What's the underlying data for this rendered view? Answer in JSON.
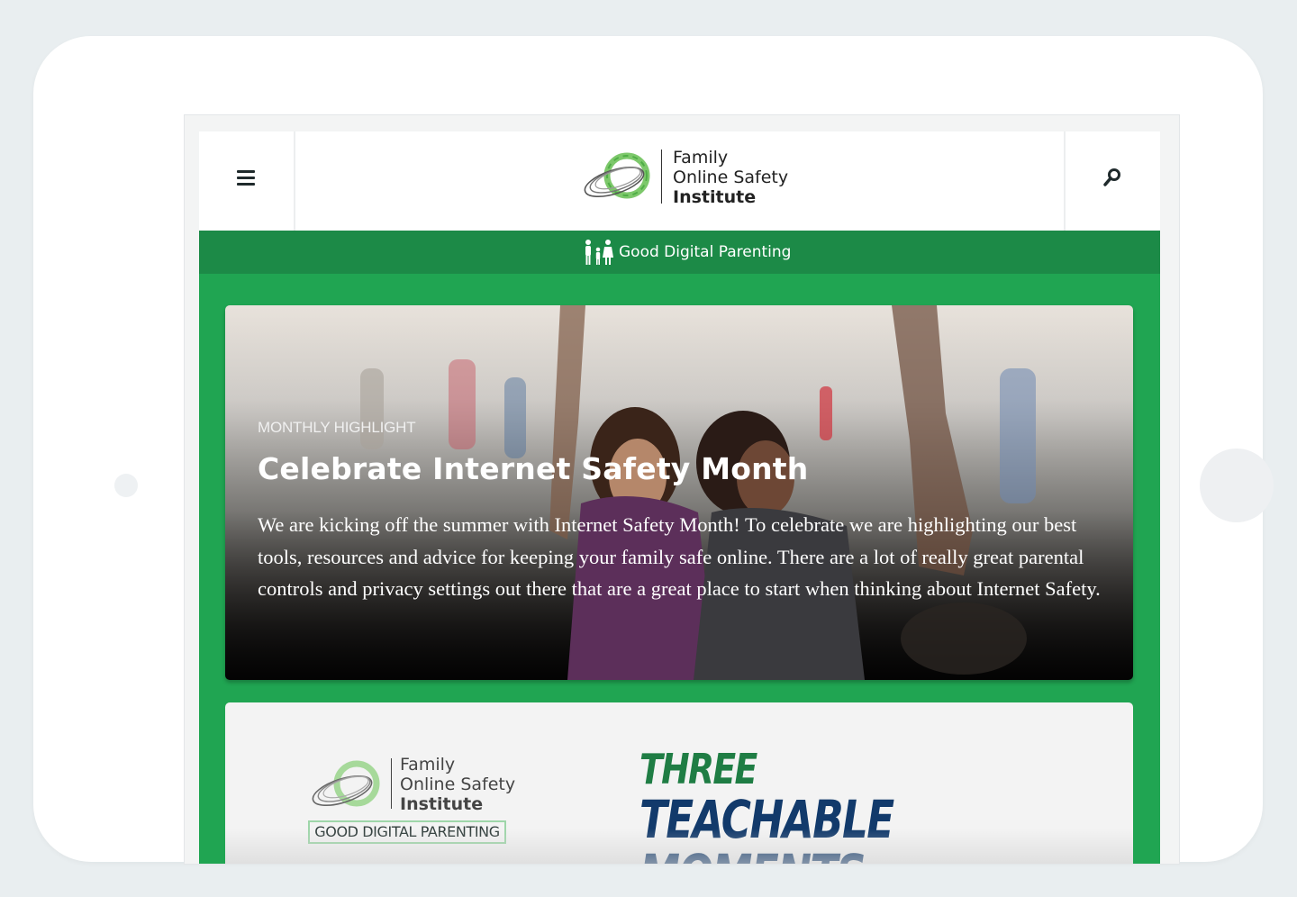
{
  "header": {
    "menu_icon": "hamburger-menu-icon",
    "search_icon": "search-icon",
    "logo": {
      "line1": "Family",
      "line2": "Online Safety",
      "line3": "Institute"
    }
  },
  "topic_bar": {
    "icon": "family-icon",
    "label": "Good Digital Parenting"
  },
  "hero": {
    "kicker": "MONTHLY HIGHLIGHT",
    "title": "Celebrate Internet Safety Month",
    "body": "We are kicking off the summer with Internet Safety Month! To celebrate we are highlighting our best tools, resources and advice for keeping your family safe online. There are a lot of really great parental controls and privacy settings out there that are a great place to start when thinking about Internet Safety."
  },
  "promo": {
    "logo": {
      "line1": "Family",
      "line2": "Online Safety",
      "line3": "Institute"
    },
    "badge": "GOOD DIGITAL PARENTING",
    "headline_line1": "THREE",
    "headline_line2": "TEACHABLE MOMENTS"
  },
  "colors": {
    "brand_green": "#20a552",
    "topic_bar_green": "#1c8a47",
    "headline_blue": "#123a6b"
  }
}
